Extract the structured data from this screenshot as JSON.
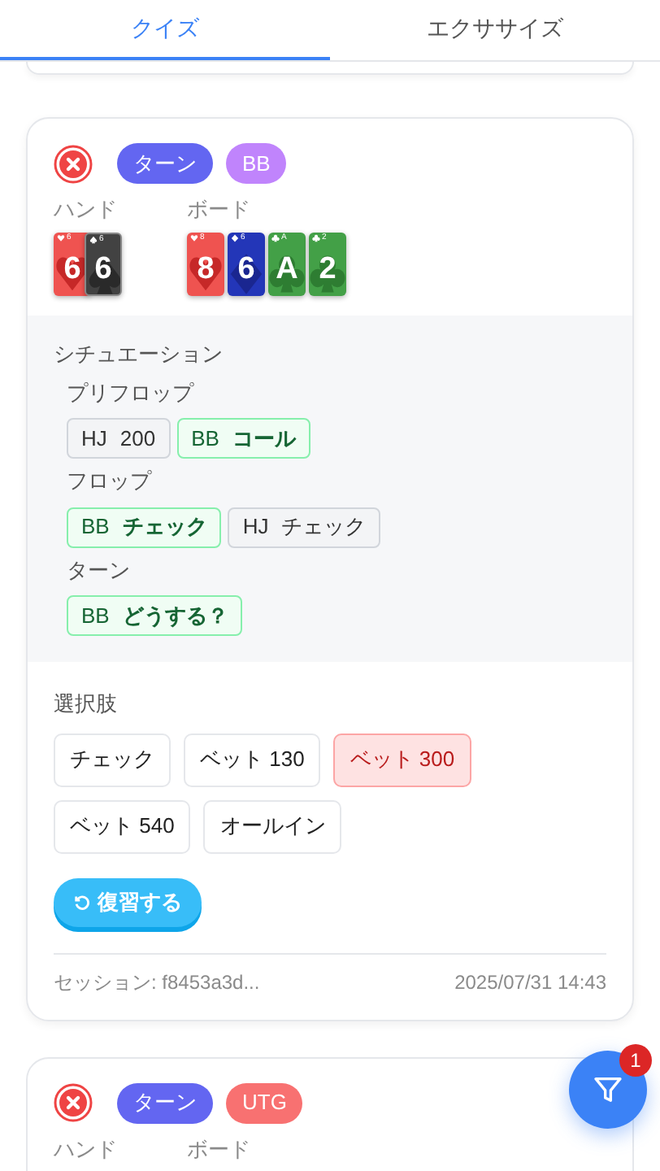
{
  "tabs": [
    {
      "label": "クイズ",
      "selected": true
    },
    {
      "label": "エクササイズ",
      "selected": false
    }
  ],
  "cards": [
    {
      "correct": false,
      "badges": [
        {
          "label": "ターン",
          "color": "#6366f1"
        },
        {
          "label": "BB",
          "color": "#c084fc"
        }
      ],
      "hand_label": "ハンド",
      "board_label": "ボード",
      "hand": [
        {
          "corner_rank": "6",
          "rank": "6",
          "kind": "hearts"
        },
        {
          "corner_rank": "6",
          "rank": "6",
          "kind": "spades"
        }
      ],
      "board": [
        {
          "corner_rank": "8",
          "rank": "8",
          "kind": "hearts"
        },
        {
          "corner_rank": "6",
          "rank": "6",
          "kind": "diamonds"
        },
        {
          "corner_rank": "A",
          "rank": "A",
          "kind": "clubs"
        },
        {
          "corner_rank": "2",
          "rank": "2",
          "kind": "clubs"
        }
      ],
      "situation": {
        "title": "シチュエーション",
        "streets": [
          {
            "name": "プリフロップ",
            "actions": [
              {
                "actor": "HJ",
                "action": "200",
                "hero": false
              },
              {
                "actor": "BB",
                "action": "コール",
                "hero": true
              }
            ]
          },
          {
            "name": "フロップ",
            "actions": [
              {
                "actor": "BB",
                "action": "チェック",
                "hero": true
              },
              {
                "actor": "HJ",
                "action": "チェック",
                "hero": false
              }
            ]
          },
          {
            "name": "ターン",
            "actions": [
              {
                "actor": "BB",
                "action": "どうする？",
                "hero": true
              }
            ]
          }
        ]
      },
      "options_label": "選択肢",
      "options": [
        {
          "label": "チェック",
          "selected": false
        },
        {
          "label": "ベット 130",
          "selected": false
        },
        {
          "label": "ベット 300",
          "selected": true
        },
        {
          "label": "ベット 540",
          "selected": false
        },
        {
          "label": "オールイン",
          "selected": false
        }
      ],
      "review_button": "復習する",
      "session": "セッション: f8453a3d...",
      "date": "2025/07/31 14:43"
    },
    {
      "correct": false,
      "badges": [
        {
          "label": "ターン",
          "color": "#6366f1"
        },
        {
          "label": "UTG",
          "color": "#f87171"
        }
      ],
      "hand_label": "ハンド",
      "board_label": "ボード"
    }
  ],
  "filter_button": {
    "badge": "1"
  }
}
